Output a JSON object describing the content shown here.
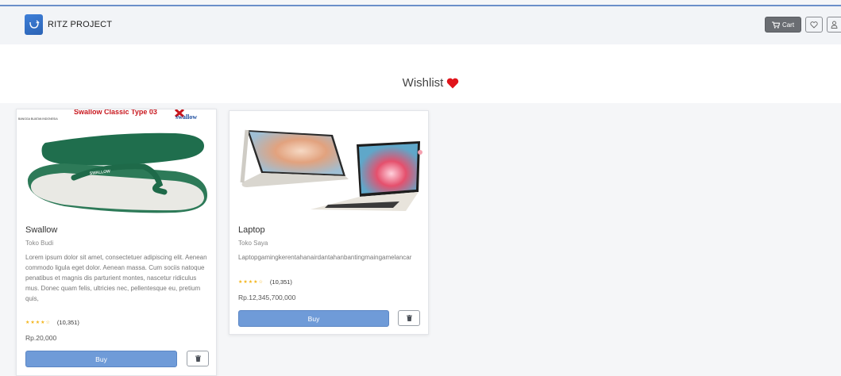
{
  "navbar": {
    "brand_name": "RITZ PROJECT",
    "cart_label": "Cart",
    "accent_color": "#6b8fc9"
  },
  "page": {
    "title": "Wishlist",
    "heart_color": "#e0141b"
  },
  "products": [
    {
      "name": "Swallow",
      "shop": "Toko Budi",
      "description": "Lorem ipsum dolor sit amet, consectetuer adipiscing elit. Aenean commodo ligula eget dolor. Aenean massa. Cum sociis natoque penatibus et magnis dis parturient montes, nascetur ridiculus mus. Donec quam felis, ultricies nec, pellentesque eu, pretium quis,",
      "stars": "★★★★☆",
      "rating_count": "(10,351)",
      "price": "Rp.20,000",
      "buy_label": "Buy",
      "image_banner_text": "Swallow Classic Type 03",
      "image_brand_text": "swallow",
      "image_strap_text": "SWALLOW",
      "image_tag_text": "BANGGA BUATAN INDONESIA"
    },
    {
      "name": "Laptop",
      "shop": "Toko Saya",
      "description": "Laptopgamingkerentahanairdantahanbantingmaingamelancar",
      "stars": "★★★★☆",
      "rating_count": "(10,351)",
      "price": "Rp.12,345,700,000",
      "buy_label": "Buy"
    }
  ]
}
